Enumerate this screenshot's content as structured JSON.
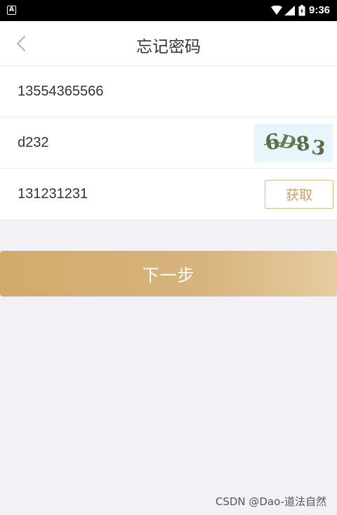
{
  "status_bar": {
    "app_icon_letter": "A",
    "time": "9:36"
  },
  "header": {
    "title": "忘记密码"
  },
  "form": {
    "phone_value": "13554365566",
    "captcha_input_value": "d232",
    "captcha_image_text": "6D83",
    "sms_code_value": "131231231",
    "get_code_label": "获取"
  },
  "next_button": {
    "label": "下一步"
  },
  "watermark": "CSDN @Dao-道法自然",
  "colors": {
    "accent": "#d4ae72",
    "background": "#f2f1f6",
    "captcha_bg": "#e8f6fb",
    "captcha_text": "#5d6b48"
  }
}
